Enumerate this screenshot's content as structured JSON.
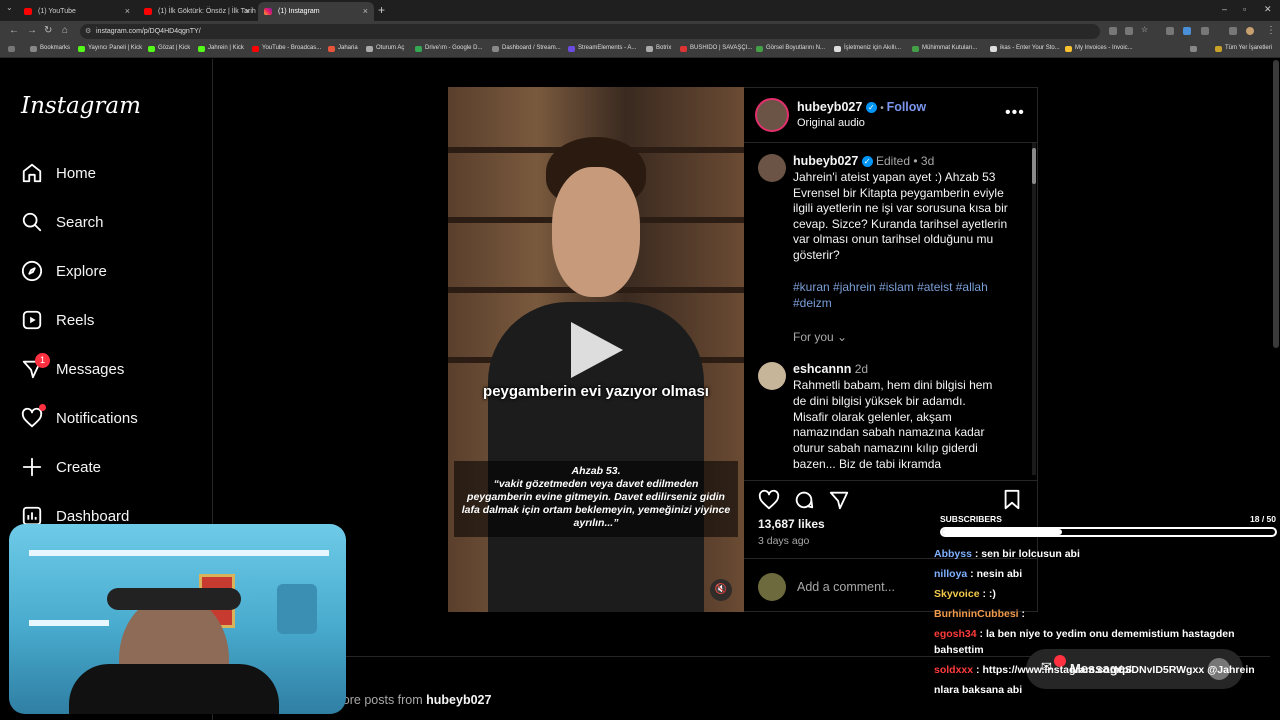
{
  "browser": {
    "tabs": [
      {
        "label": "(1) YouTube",
        "active": false
      },
      {
        "label": "(1) İlk Göktürk: Önsöz | İlk Tarih",
        "active": false
      },
      {
        "label": "(1) Instagram",
        "active": true
      }
    ],
    "url": "instagram.com/p/DQ4HD4qgnTY/",
    "bookmarks": [
      "Bookmarks",
      "Yayıncı Paneli | Kick",
      "Gözat | Kick",
      "Jahrein | Kick",
      "YouTube - Broadcas...",
      "Jaharia",
      "Oturum Aç",
      "Drive'ım - Google D...",
      "Dashboard / Stream...",
      "StreamElements - A...",
      "Botrix",
      "BUSHIDO | SAVAŞÇI...",
      "Görsel Boyutlarını N...",
      "İşletmeniz için Akıllı...",
      "Mühimmat Kutuları...",
      "ikas - Enter Your Sto...",
      "My Invoices - Invoic..."
    ],
    "all_bookmarks": "Tüm Yer İşaretleri"
  },
  "instagram": {
    "logo": "Instagram",
    "nav": [
      {
        "label": "Home",
        "icon": "home-icon"
      },
      {
        "label": "Search",
        "icon": "search-icon"
      },
      {
        "label": "Explore",
        "icon": "explore-icon"
      },
      {
        "label": "Reels",
        "icon": "reels-icon"
      },
      {
        "label": "Messages",
        "icon": "messages-icon",
        "badge": "1"
      },
      {
        "label": "Notifications",
        "icon": "heart-icon"
      },
      {
        "label": "Create",
        "icon": "plus-icon"
      },
      {
        "label": "Dashboard",
        "icon": "dashboard-icon"
      }
    ]
  },
  "post": {
    "header": {
      "username": "hubeyb027",
      "follow": "Follow",
      "audio": "Original audio"
    },
    "video": {
      "caption": "peygamberin evi yazıyor olması",
      "quote_title": "Ahzab 53.",
      "quote": "“vakit gözetmeden veya davet edilmeden peygamberin evine gitmeyin. Davet edilirseniz gidin lafa dalmak için ortam beklemeyin, yemeğinizi yiyince ayrılın...”"
    },
    "caption": {
      "username": "hubeyb027",
      "edited": "Edited",
      "age": "3d",
      "text": "Jahrein'i ateist yapan ayet :) Ahzab 53 Evrensel bir Kitapta peygamberin eviyle ilgili ayetlerin ne işi var sorusuna kısa bir cevap. Sizce? Kuranda tarihsel ayetlerin var olması onun tarihsel olduğunu mu gösterir?",
      "hashtags": "#kuran #jahrein #islam #ateist #allah #deizm",
      "for_you": "For you"
    },
    "comment": {
      "username": "eshcannn",
      "age": "2d",
      "text": "Rahmetli babam, hem dini bilgisi hem de dini bilgisi yüksek bir adamdı. Misafir olarak gelenler, akşam namazından sabah namazına kadar oturur sabah namazını kılıp giderdi bazen... Biz de tabi ikramda"
    },
    "likes": "13,687 likes",
    "posted": "3 days ago",
    "add_comment": "Add a comment...",
    "more_posts_prefix": "lore posts from ",
    "more_posts_user": "hubeyb027"
  },
  "stream": {
    "subscribers_label": "SUBSCRIBERS",
    "subscribers_count": "18 / 50",
    "subscribers_progress": 0.36,
    "chat": [
      {
        "user": "Abbyss",
        "color": "#7fb0ff",
        "text": "sen bir lolcusun abi"
      },
      {
        "user": "nilloya",
        "color": "#7fb0ff",
        "text": "nesin abi"
      },
      {
        "user": "Skyvoice",
        "color": "#f2c94c",
        "text": ":)"
      },
      {
        "user": "BurhininCubbesi",
        "color": "#f2994a",
        "text": ""
      },
      {
        "user": "egosh34",
        "color": "#ff3b3b",
        "text": "la ben niye to yedim onu dememistium hastagden bahsettim"
      },
      {
        "user": "soldxxx",
        "color": "#ff3b3b",
        "text": "https://www.instagram.com/p/DNvID5RWgxx @Jahrein"
      },
      {
        "user": "",
        "color": "#fff",
        "text": "nlara baksana abi"
      }
    ],
    "messages_pill": "Messages"
  }
}
